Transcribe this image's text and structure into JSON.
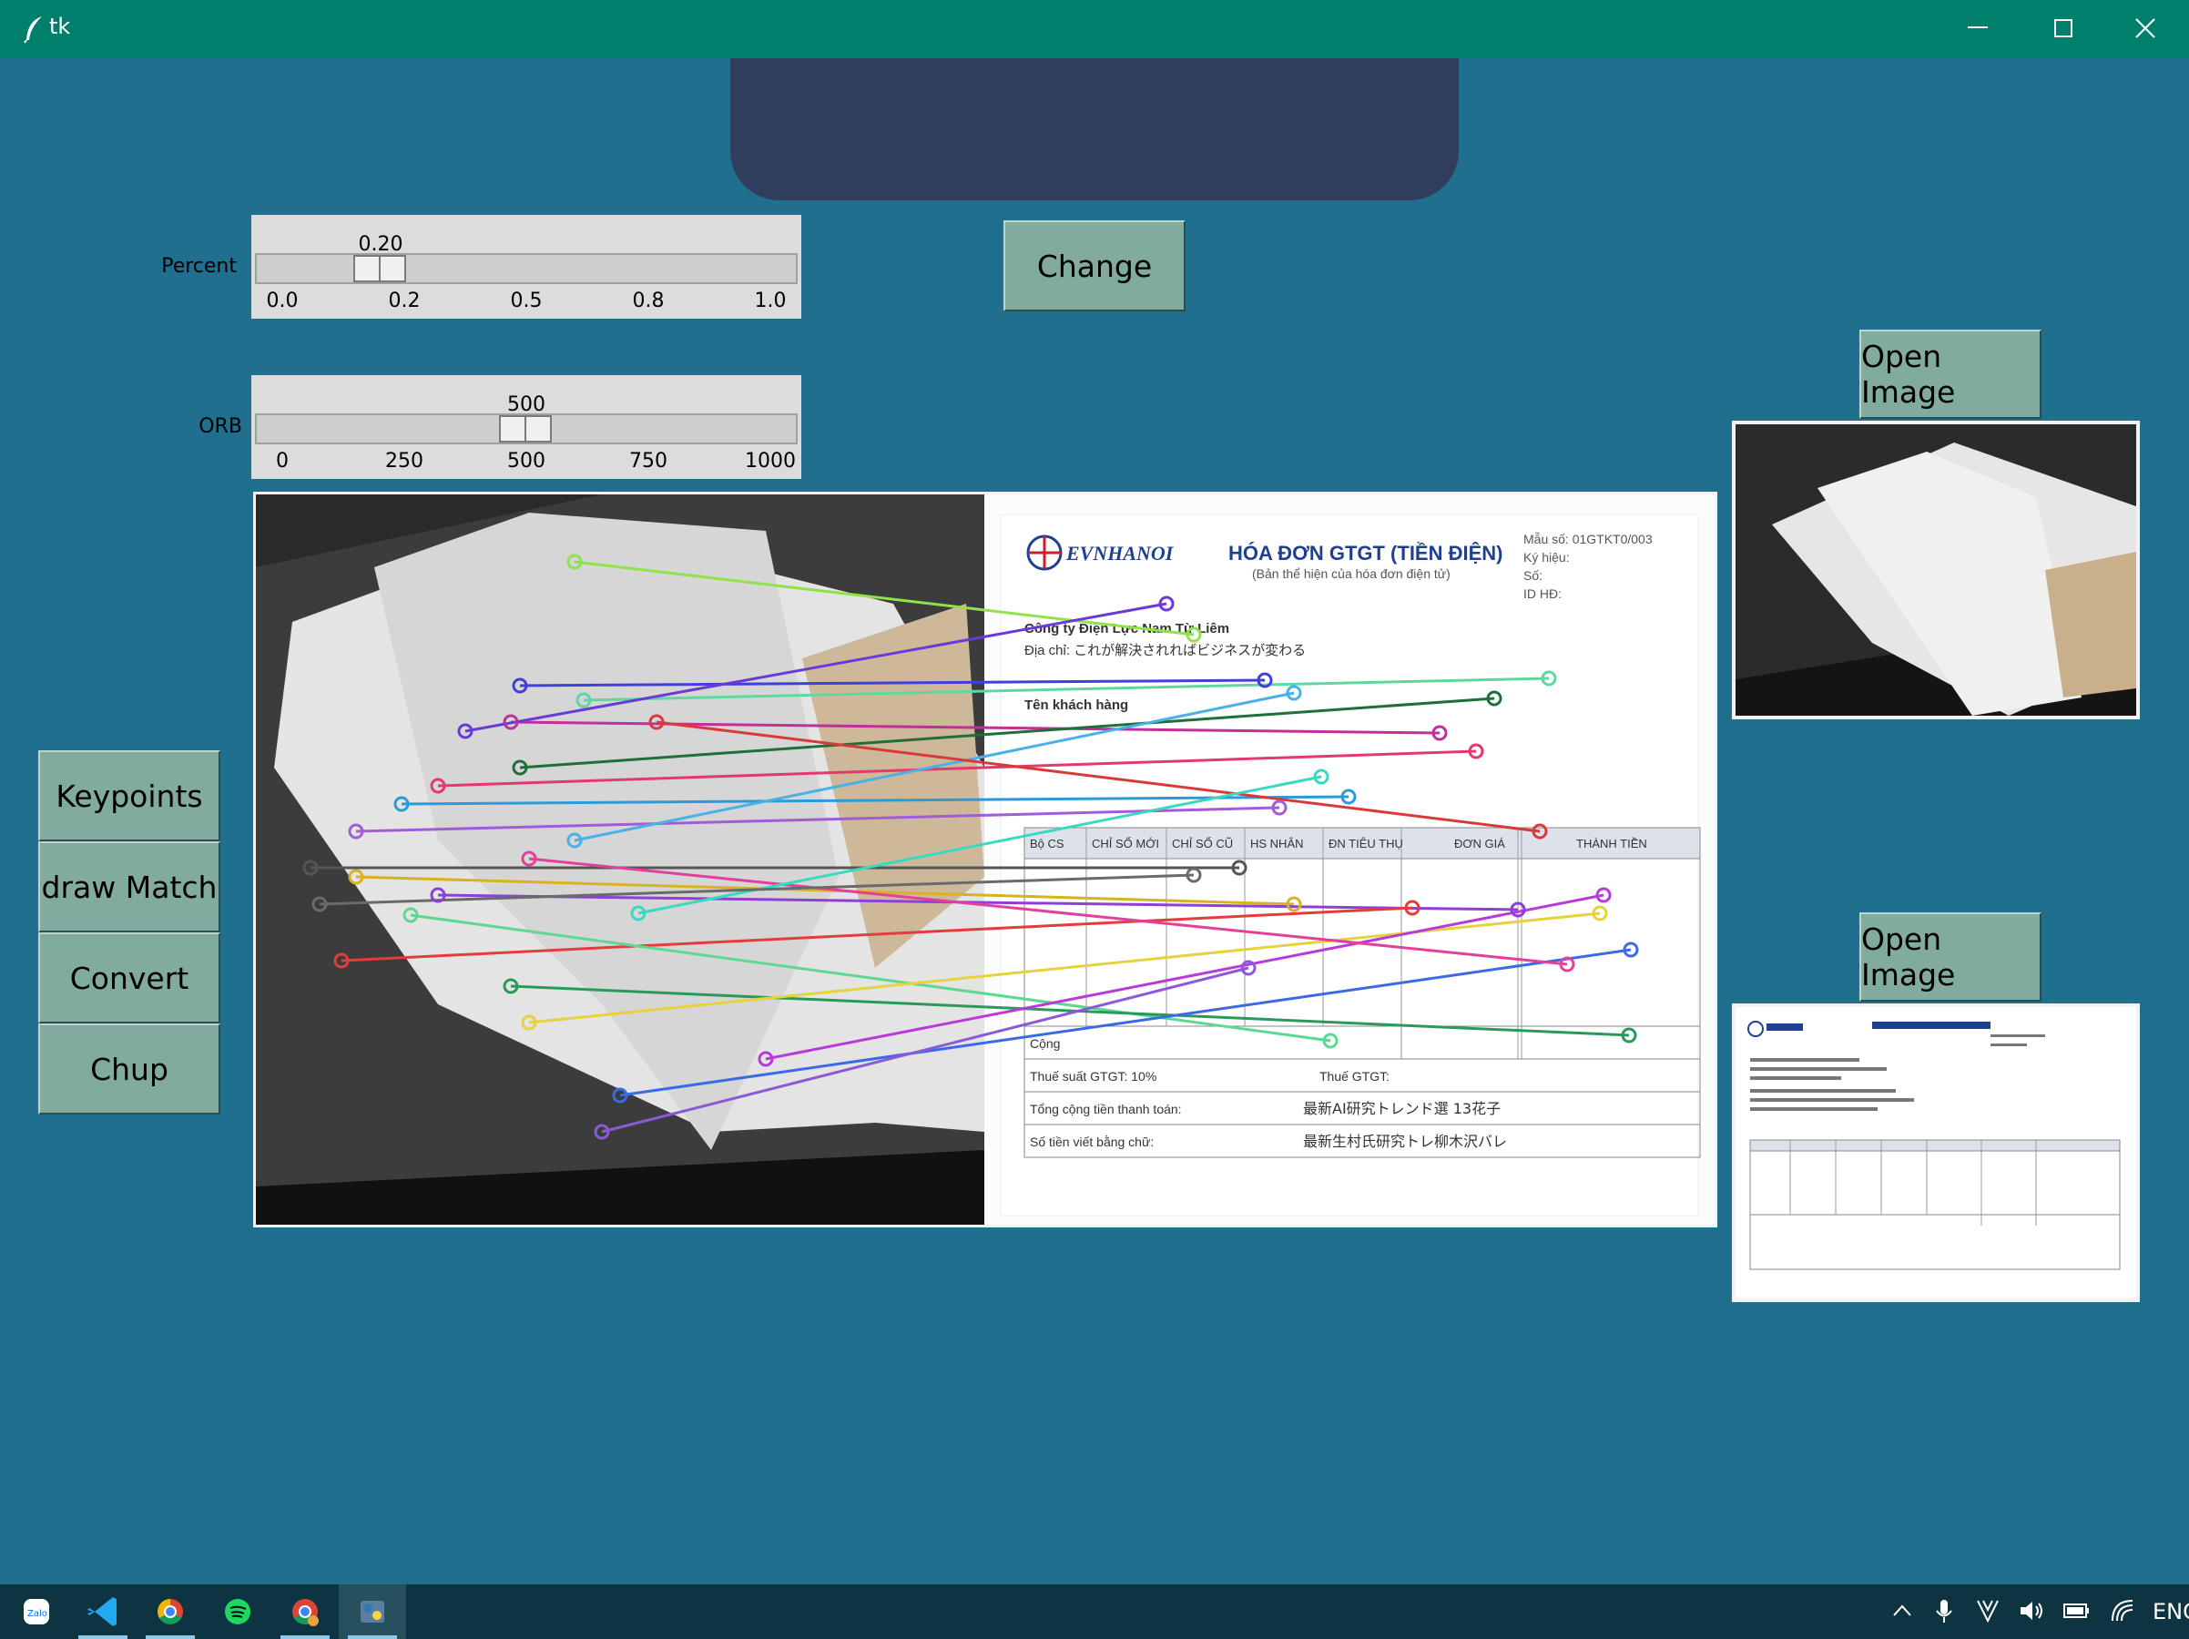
{
  "window": {
    "title": "tk"
  },
  "controls": {
    "change_label": "Change",
    "percent": {
      "label": "Percent",
      "value": "0.20",
      "fraction": 0.2,
      "ticks": [
        "0.0",
        "0.2",
        "0.5",
        "0.8",
        "1.0"
      ]
    },
    "orb": {
      "label": "ORB",
      "value": "500",
      "fraction": 0.5,
      "ticks": [
        "0",
        "250",
        "500",
        "750",
        "1000"
      ]
    }
  },
  "sidebar": {
    "buttons": [
      "Keypoints",
      "draw Match",
      "Convert",
      "Chup"
    ]
  },
  "right_panel": {
    "open_image_1": "Open Image",
    "open_image_2": "Open Image"
  },
  "invoice": {
    "brand": "EVNHANOI",
    "title": "HÓA ĐƠN GTGT (TIỀN ĐIỆN)",
    "subtitle": "(Bản thể hiện của hóa đơn điện tử)",
    "company": "Công ty Điện Lực Nam Từ Liêm",
    "address": "Địa chỉ: これが解決されればビジネスが変わる",
    "customer": "Tên khách hàng",
    "form_no": "Mẫu số: 01GTKT0/003",
    "symbol": "Ký hiệu:",
    "number": "Số:",
    "id": "ID HĐ:",
    "table_headers": [
      "Bộ CS",
      "CHỈ SỐ MỚI",
      "CHỈ SỐ CŨ",
      "HS NHÂN",
      "ĐN TIÊU THỤ",
      "ĐƠN GIÁ",
      "THÀNH TIỀN"
    ],
    "cong": "Cộng",
    "tax_rate": "Thuế suất GTGT: 10%",
    "tax": "Thuế GTGT:",
    "total": "Tổng cộng tiền thanh toán:",
    "total_value": "最新AI研究トレンド選 13花子",
    "in_words": "Số tiền viết bằng chữ:",
    "in_words_value": "最新生村氏研究トレ柳木沢バレ"
  },
  "taskbar": {
    "lang": "ENG"
  }
}
